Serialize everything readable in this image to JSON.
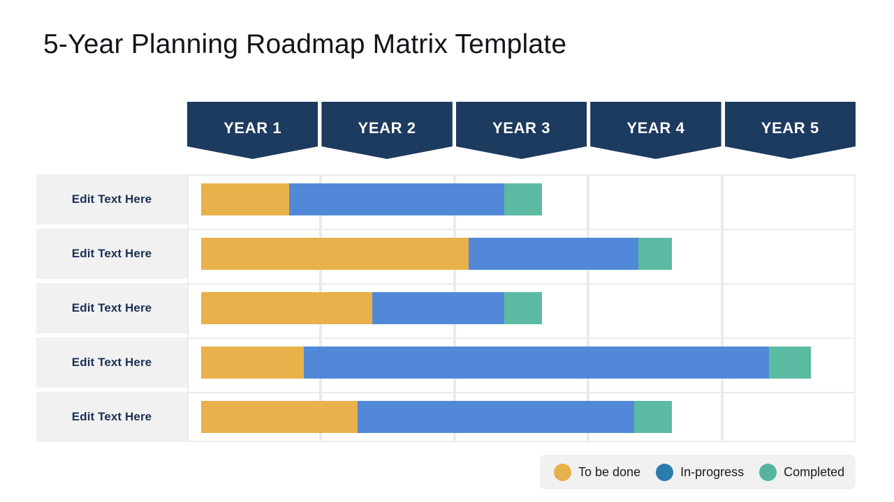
{
  "title": "5-Year Planning Roadmap Matrix Template",
  "columns": [
    {
      "label": "YEAR 1"
    },
    {
      "label": "YEAR 2"
    },
    {
      "label": "YEAR 3"
    },
    {
      "label": "YEAR 4"
    },
    {
      "label": "YEAR 5"
    }
  ],
  "rows": [
    {
      "label": "Edit Text Here"
    },
    {
      "label": "Edit Text Here"
    },
    {
      "label": "Edit Text Here"
    },
    {
      "label": "Edit Text Here"
    },
    {
      "label": "Edit Text Here"
    }
  ],
  "legend": {
    "items": [
      {
        "label": "To be done",
        "color": "#e6b24c",
        "status": "todo"
      },
      {
        "label": "In-progress",
        "color": "#2b7cab",
        "status": "in-progress"
      },
      {
        "label": "Completed",
        "color": "#55b59c",
        "status": "completed"
      }
    ]
  },
  "colors": {
    "header_navy": "#1d3a5f",
    "row_label_bg": "#f1f1f1",
    "bar_todo": "#e9b14b",
    "bar_in_progress": "#5189d8",
    "bar_completed": "#5bbba2",
    "grid_line": "#ebebeb",
    "title_text": "#111418",
    "row_label_text": "#1b2f54"
  },
  "chart_data": {
    "type": "bar",
    "title": "5-Year Planning Roadmap Matrix Template",
    "xlabel": "",
    "ylabel": "",
    "orientation": "horizontal",
    "stacked": true,
    "grid": true,
    "legend_position": "bottom-right",
    "categories": [
      "YEAR 1",
      "YEAR 2",
      "YEAR 3",
      "YEAR 4",
      "YEAR 5"
    ],
    "x_axis_unit": "years",
    "xlim": [
      0,
      5
    ],
    "series": [
      {
        "name": "To be done",
        "color": "#e9b14b",
        "values": [
          0.66,
          2.0,
          1.28,
          0.77,
          1.17
        ]
      },
      {
        "name": "In-progress",
        "color": "#5189d8",
        "values": [
          1.61,
          1.27,
          0.99,
          3.48,
          2.07
        ]
      },
      {
        "name": "Completed",
        "color": "#5bbba2",
        "values": [
          0.28,
          0.25,
          0.28,
          0.3,
          0.28
        ]
      }
    ],
    "rows": [
      {
        "label": "Edit Text Here",
        "segments": [
          {
            "status": "To be done",
            "start": 0.0,
            "end": 0.66
          },
          {
            "status": "In-progress",
            "start": 0.66,
            "end": 2.27
          },
          {
            "status": "Completed",
            "start": 2.27,
            "end": 2.55
          }
        ]
      },
      {
        "label": "Edit Text Here",
        "segments": [
          {
            "status": "To be done",
            "start": 0.0,
            "end": 2.0
          },
          {
            "status": "In-progress",
            "start": 2.0,
            "end": 3.27
          },
          {
            "status": "Completed",
            "start": 3.27,
            "end": 3.52
          }
        ]
      },
      {
        "label": "Edit Text Here",
        "segments": [
          {
            "status": "To be done",
            "start": 0.0,
            "end": 1.28
          },
          {
            "status": "In-progress",
            "start": 1.28,
            "end": 2.27
          },
          {
            "status": "Completed",
            "start": 2.27,
            "end": 2.55
          }
        ]
      },
      {
        "label": "Edit Text Here",
        "segments": [
          {
            "status": "To be done",
            "start": 0.0,
            "end": 0.77
          },
          {
            "status": "In-progress",
            "start": 0.77,
            "end": 4.25
          },
          {
            "status": "Completed",
            "start": 4.25,
            "end": 4.56
          }
        ]
      },
      {
        "label": "Edit Text Here",
        "segments": [
          {
            "status": "To be done",
            "start": 0.0,
            "end": 1.17
          },
          {
            "status": "In-progress",
            "start": 1.17,
            "end": 3.24
          },
          {
            "status": "Completed",
            "start": 3.24,
            "end": 3.52
          }
        ]
      }
    ]
  }
}
